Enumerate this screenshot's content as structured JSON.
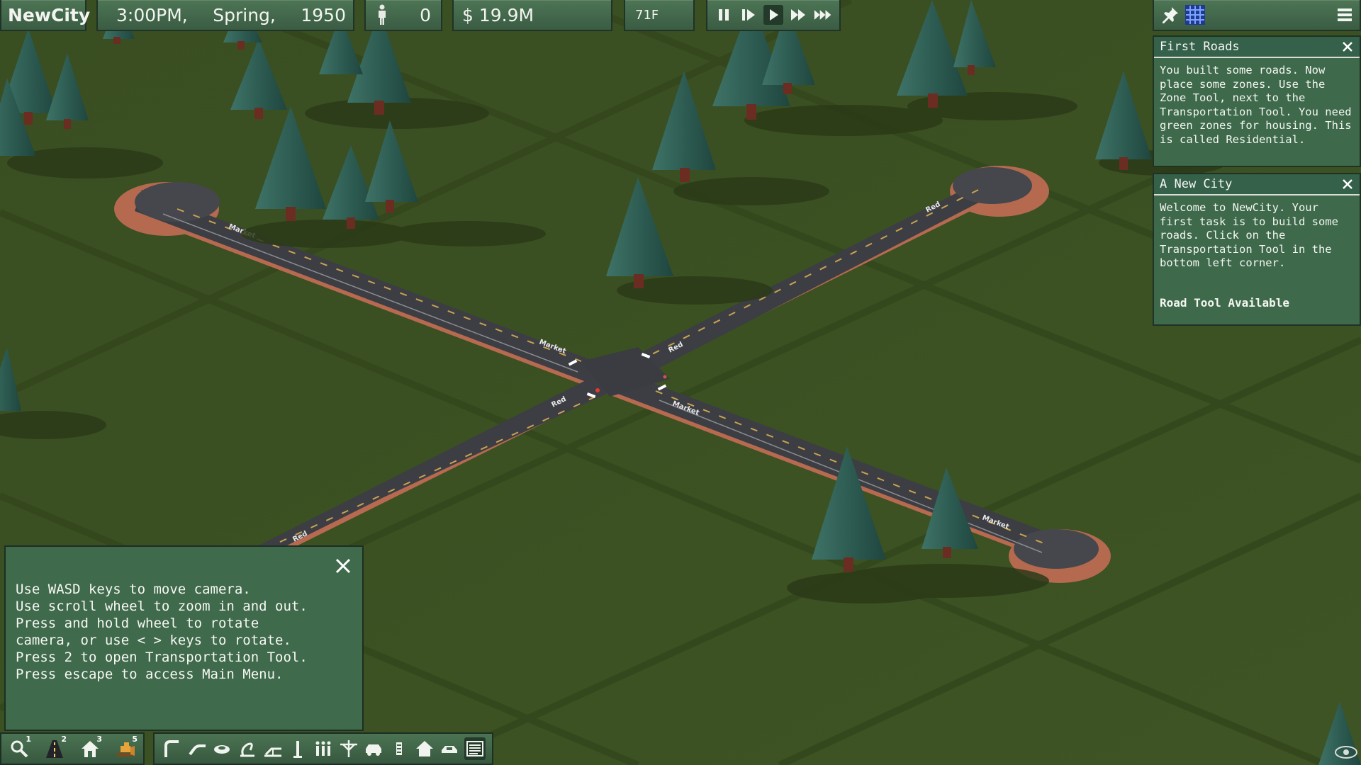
{
  "topbar": {
    "city_name": "NewCity",
    "time": "3:00PM,",
    "season": "Spring,",
    "year": "1950",
    "population": "0",
    "money": "$ 19.9M",
    "temperature": "71F"
  },
  "speed_controls": [
    "pause",
    "step",
    "play",
    "fast",
    "fastest"
  ],
  "active_speed": "play",
  "top_right_tools": [
    "pin-icon",
    "grid-icon",
    "menu-icon"
  ],
  "panels": {
    "first_roads": {
      "title": "First Roads",
      "body": "You built some roads. Now\nplace some zones. Use the\nZone Tool, next to the\nTransportation Tool. You need\ngreen zones for housing. This\nis called Residential."
    },
    "a_new_city": {
      "title": "A New City",
      "body": "Welcome to NewCity. Your\nfirst task is to build some\nroads. Click on the\nTransportation Tool in the\nbottom left corner.",
      "available": "Road Tool Available"
    }
  },
  "help": {
    "body": "Use WASD keys to move camera.\nUse scroll wheel to zoom in and out.\nPress and hold wheel to rotate\ncamera, or use < > keys to rotate.\nPress 2 to open Transportation Tool.\nPress escape to access Main Menu."
  },
  "toolbar_left": [
    {
      "icon": "query-icon",
      "num": "1"
    },
    {
      "icon": "transportation-icon",
      "num": "2"
    },
    {
      "icon": "zone-icon",
      "num": "3"
    },
    {
      "icon": "bulldozer-icon",
      "num": "5"
    }
  ],
  "toolbar_right": [
    "road-icon",
    "road-curve-icon",
    "roundabout-icon",
    "expressway-icon",
    "slope-icon",
    "pillar-icon",
    "pedestrian-icon",
    "transit-icon",
    "vehicle-icon",
    "signal-icon",
    "home-icon",
    "car-icon",
    "list-icon"
  ],
  "road_labels": [
    "Market",
    "Market",
    "Red",
    "Red",
    "Market",
    "Market",
    "Red",
    "Red"
  ],
  "colors": {
    "grass": "#3b4f22",
    "panel": "#3e6a4b",
    "road": "#3c3e44",
    "road_edge": "#c57a60",
    "tree": "#2f5e54"
  }
}
